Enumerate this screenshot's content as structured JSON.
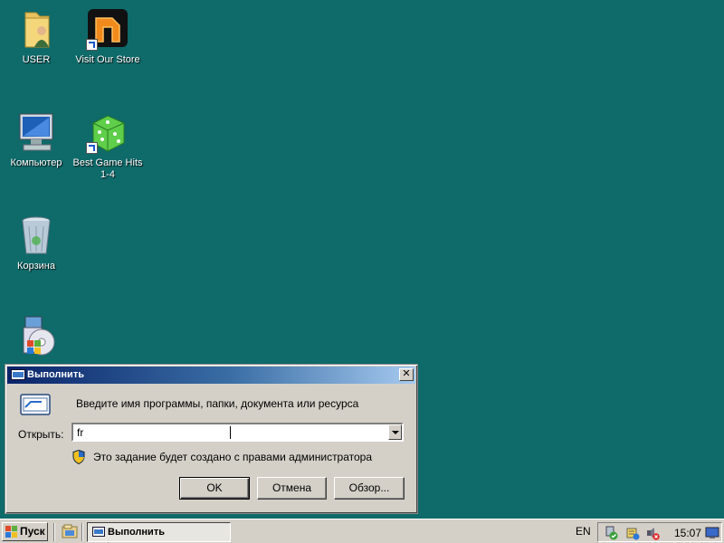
{
  "desktop": {
    "icons": [
      {
        "label": "USER"
      },
      {
        "label": "Visit Our Store"
      },
      {
        "label": "Компьютер"
      },
      {
        "label": "Best Game Hits 1-4"
      },
      {
        "label": "Корзина"
      },
      {
        "label": ""
      }
    ]
  },
  "run_dialog": {
    "title": "Выполнить",
    "prompt": "Введите имя программы, папки, документа или ресурса",
    "open_label": "Открыть:",
    "open_value": "fr",
    "admin_note": "Это задание будет создано с правами администратора",
    "ok_label": "OK",
    "cancel_label": "Отмена",
    "browse_label": "Обзор..."
  },
  "taskbar": {
    "start_label": "Пуск",
    "task_label": "Выполнить",
    "language": "EN",
    "clock": "15:07"
  },
  "colors": {
    "desktop_bg": "#0f6a6a",
    "title_gradient_start": "#0a246a",
    "title_gradient_end": "#a6caf0",
    "face": "#d4d0c8"
  }
}
